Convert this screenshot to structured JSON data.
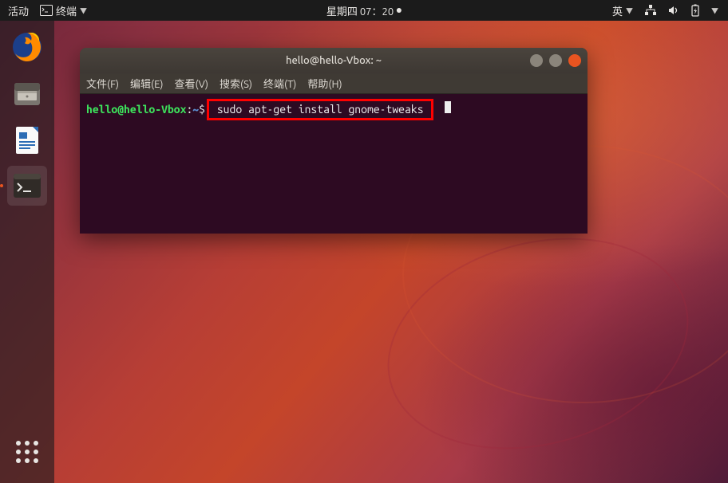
{
  "topPanel": {
    "activities": "活动",
    "appName": "终端",
    "datetime": "星期四 07：20",
    "ime": "英"
  },
  "dock": {
    "items": [
      {
        "name": "firefox"
      },
      {
        "name": "files"
      },
      {
        "name": "libreoffice-writer"
      },
      {
        "name": "terminal"
      }
    ]
  },
  "window": {
    "title": "hello@hello-Vbox: ~",
    "menus": {
      "file": "文件(F)",
      "edit": "编辑(E)",
      "view": "查看(V)",
      "search": "搜索(S)",
      "terminal": "终端(T)",
      "help": "帮助(H)"
    }
  },
  "terminal": {
    "prompt": {
      "userHost": "hello@hello-Vbox",
      "colon": ":",
      "path": "~",
      "sign": "$"
    },
    "command": " sudo apt-get install gnome-tweaks "
  }
}
